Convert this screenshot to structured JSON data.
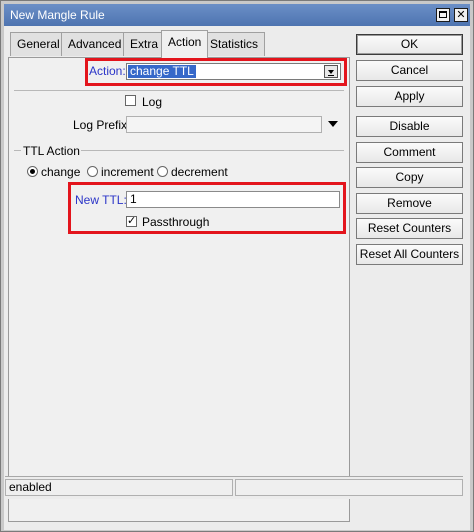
{
  "window": {
    "title": "New Mangle Rule"
  },
  "tabs": [
    {
      "label": "General"
    },
    {
      "label": "Advanced"
    },
    {
      "label": "Extra"
    },
    {
      "label": "Action"
    },
    {
      "label": "Statistics"
    }
  ],
  "action": {
    "label": "Action:",
    "value": "change TTL"
  },
  "log": {
    "label": "Log",
    "checked": false
  },
  "log_prefix": {
    "label": "Log Prefix:",
    "value": ""
  },
  "ttl_action": {
    "group_label": "TTL Action",
    "options": [
      "change",
      "increment",
      "decrement"
    ],
    "selected": "change"
  },
  "new_ttl": {
    "label": "New TTL:",
    "value": "1"
  },
  "passthrough": {
    "label": "Passthrough",
    "checked": true
  },
  "buttons": {
    "ok": "OK",
    "cancel": "Cancel",
    "apply": "Apply",
    "disable": "Disable",
    "comment": "Comment",
    "copy": "Copy",
    "remove": "Remove",
    "reset_counters": "Reset Counters",
    "reset_all_counters": "Reset All Counters"
  },
  "status": {
    "text": "enabled"
  },
  "colors": {
    "highlight_box": "#e3141c",
    "label_blue": "#2b35c8",
    "titlebar": "#5a80bc"
  }
}
